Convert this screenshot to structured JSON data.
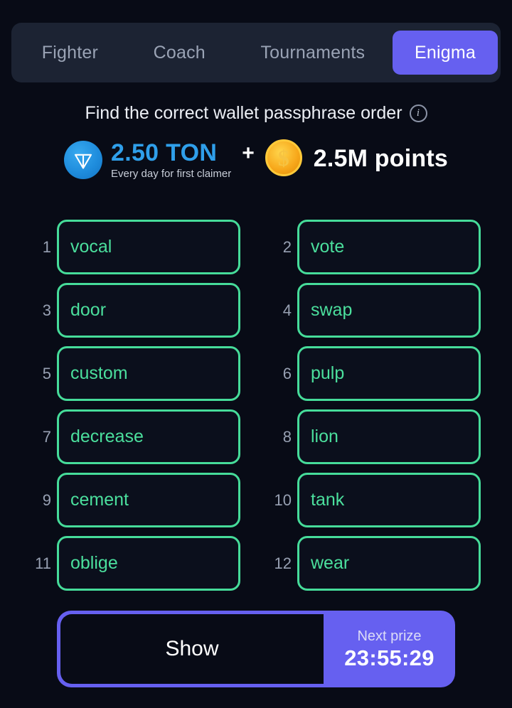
{
  "theme": {
    "background": "#080b16",
    "tabbar_bg": "#1c2333",
    "accent_purple": "#6660f0",
    "accent_green": "#46dc9a",
    "ton_blue": "#2f9fea",
    "coin_gold": "#f7a81b"
  },
  "tabs": [
    {
      "label": "Fighter",
      "active": false
    },
    {
      "label": "Coach",
      "active": false
    },
    {
      "label": "Tournaments",
      "active": false
    },
    {
      "label": "Enigma",
      "active": true
    }
  ],
  "header": {
    "title": "Find the correct wallet passphrase order",
    "info_icon": "info-circle-icon"
  },
  "prize": {
    "ton_icon": "ton-coin-icon",
    "ton_amount": "2.50 TON",
    "ton_subtitle": "Every day for first claimer",
    "separator": "+",
    "coin_icon": "gold-coin-icon",
    "points_amount": "2.5M points"
  },
  "words": [
    {
      "number": "1",
      "word": "vocal"
    },
    {
      "number": "2",
      "word": "vote"
    },
    {
      "number": "3",
      "word": "door"
    },
    {
      "number": "4",
      "word": "swap"
    },
    {
      "number": "5",
      "word": "custom"
    },
    {
      "number": "6",
      "word": "pulp"
    },
    {
      "number": "7",
      "word": "decrease"
    },
    {
      "number": "8",
      "word": "lion"
    },
    {
      "number": "9",
      "word": "cement"
    },
    {
      "number": "10",
      "word": "tank"
    },
    {
      "number": "11",
      "word": "oblige"
    },
    {
      "number": "12",
      "word": "wear"
    }
  ],
  "footer": {
    "show_label": "Show",
    "next_prize_label": "Next prize",
    "next_prize_timer": "23:55:29"
  }
}
